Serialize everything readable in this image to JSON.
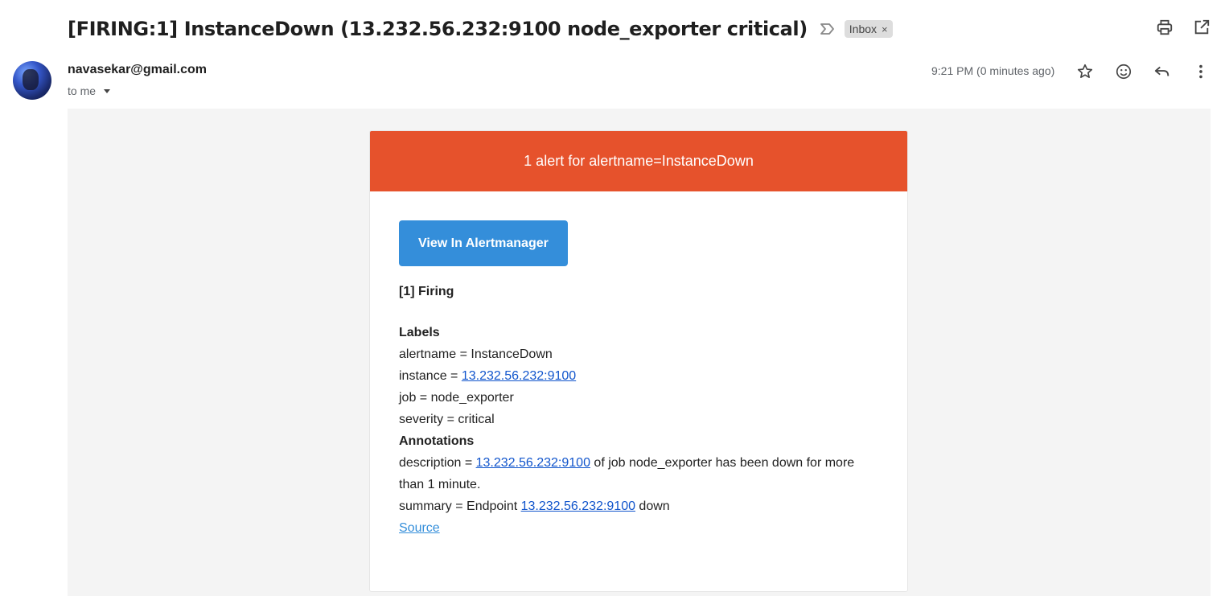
{
  "header": {
    "subject": "[FIRING:1] InstanceDown (13.232.56.232:9100 node_exporter critical)",
    "label_chip": "Inbox",
    "label_chip_close": "×"
  },
  "message": {
    "sender": "navasekar@gmail.com",
    "recipient": "to me",
    "timestamp": "9:21 PM (0 minutes ago)"
  },
  "alert": {
    "header_title": "1 alert for alertname=InstanceDown",
    "button_label": "View In Alertmanager",
    "firing_title": "[1] Firing",
    "labels_heading": "Labels",
    "labels": {
      "alertname": "alertname = InstanceDown",
      "instance_prefix": "instance = ",
      "instance_link": "13.232.56.232:9100",
      "job": "job = node_exporter",
      "severity": "severity = critical"
    },
    "annotations_heading": "Annotations",
    "annotations": {
      "description_prefix": "description = ",
      "description_link": "13.232.56.232:9100",
      "description_suffix": " of job node_exporter has been down for more than 1 minute.",
      "summary_prefix": "summary = Endpoint ",
      "summary_link": "13.232.56.232:9100",
      "summary_suffix": " down"
    },
    "source_link": "Source"
  },
  "colors": {
    "alert_header": "#e6522c",
    "button": "#348eda",
    "link": "#1155cc",
    "body_background": "#f4f4f4"
  },
  "icons": [
    "important-marker-icon",
    "print-icon",
    "open-in-new-window-icon",
    "star-icon",
    "emoji-react-icon",
    "reply-icon",
    "more-vert-icon",
    "dropdown-caret-icon"
  ]
}
